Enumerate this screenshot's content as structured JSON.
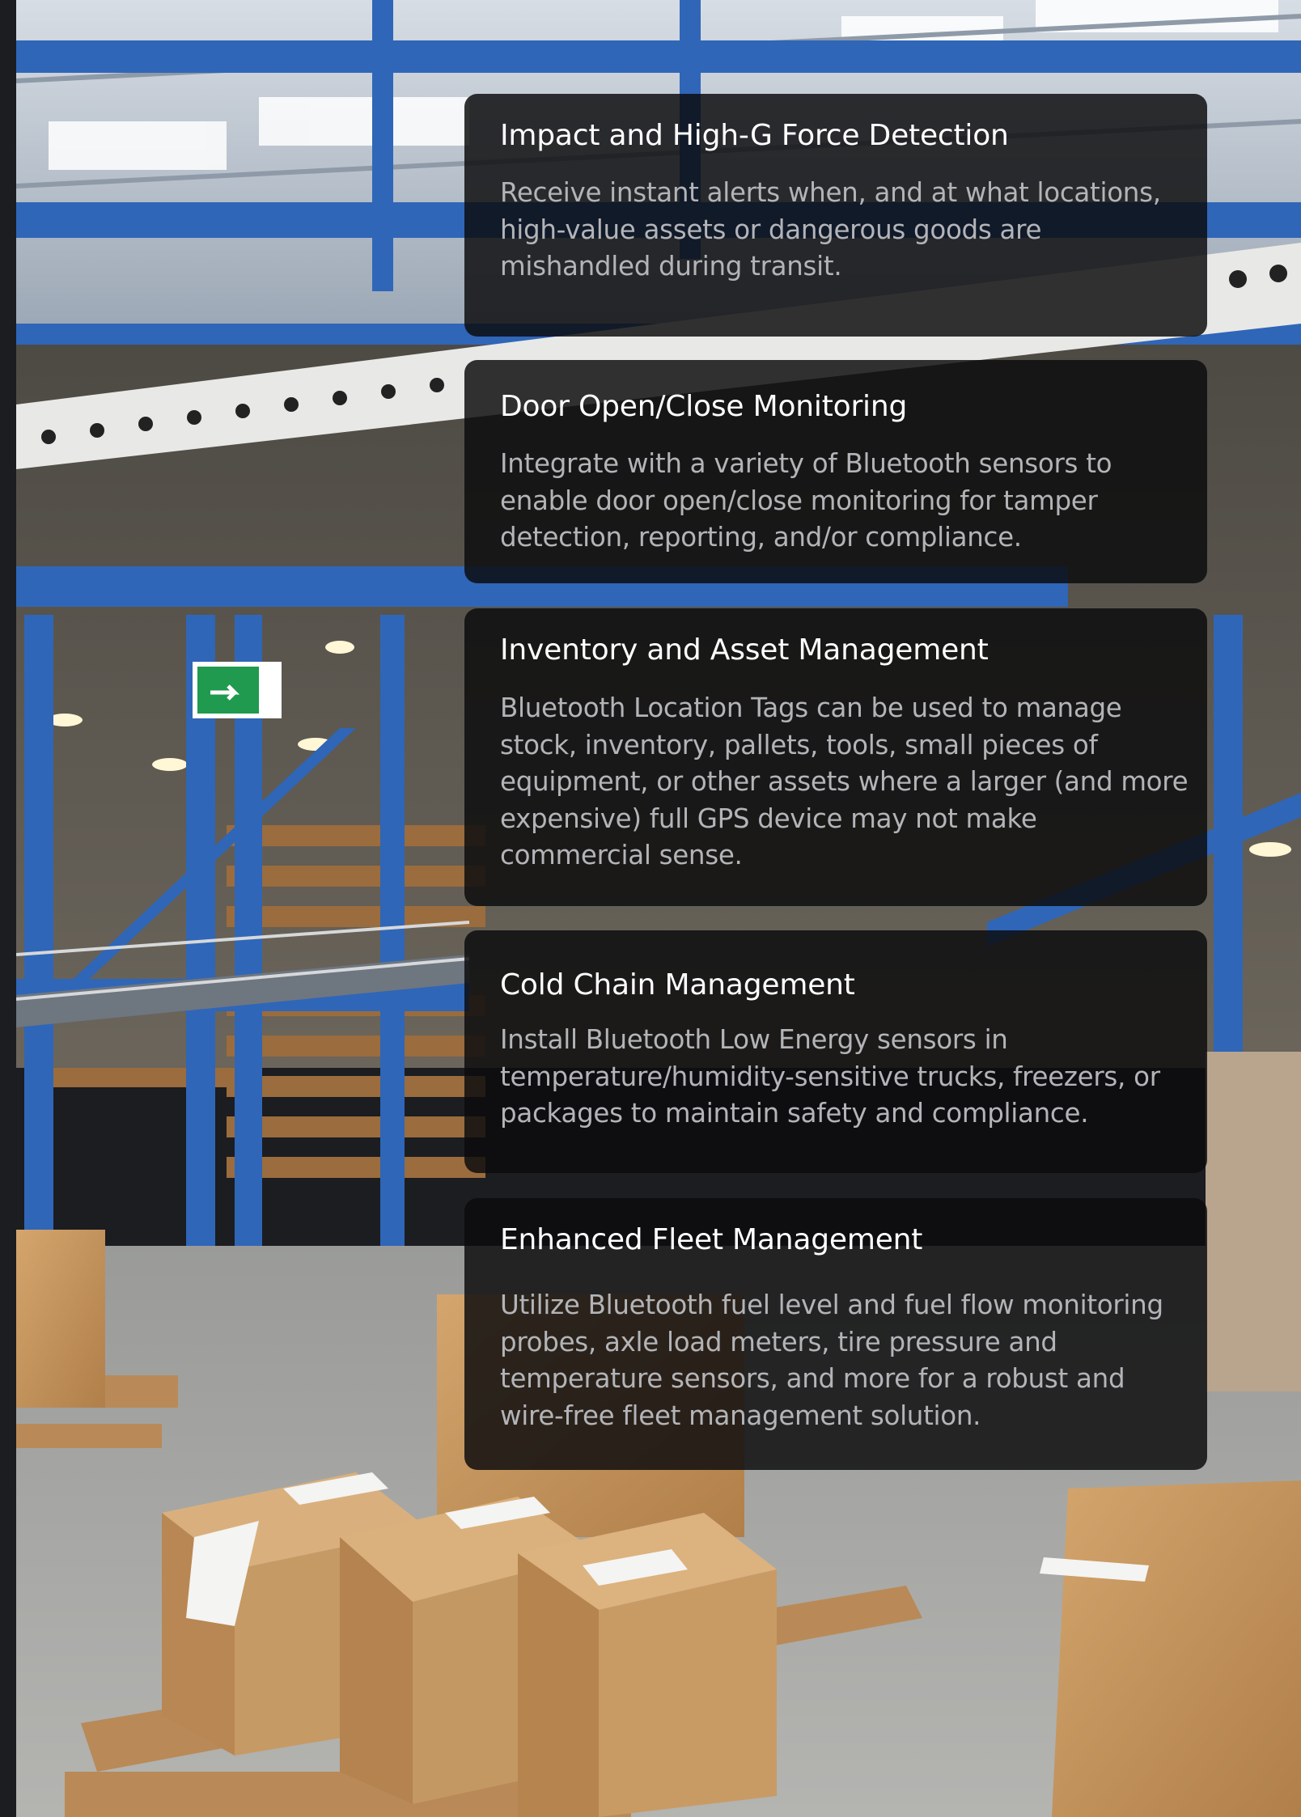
{
  "background": {
    "image_subject": "warehouse-conveyor-and-cardboard-boxes"
  },
  "colors": {
    "card_background": "#0c0c0d",
    "title_text": "#ffffff",
    "body_text": "#b3b4b8",
    "steel_blue": "#2f66b8",
    "cardboard": "#c2955f"
  },
  "cards": [
    {
      "title": "Impact and High-G Force Detection",
      "text": "Receive instant alerts when, and at what locations, high-value assets or dangerous goods are mishandled during transit."
    },
    {
      "title": "Door Open/Close Monitoring",
      "text": "Integrate with a variety of Bluetooth sensors to enable door open/close monitoring for tamper detection, reporting, and/or compliance."
    },
    {
      "title": "Inventory and Asset Management",
      "text": "Bluetooth Location Tags can be used to manage stock, inventory, pallets, tools, small pieces of equipment, or other assets where a larger (and more expensive) full GPS device may not make commercial sense."
    },
    {
      "title": "Cold Chain Management",
      "text": "Install Bluetooth Low Energy sensors in temperature/humidity-sensitive trucks, freezers, or packages to maintain safety and compliance."
    },
    {
      "title": "Enhanced Fleet Management",
      "text": "Utilize Bluetooth fuel level and fuel flow monitoring probes, axle load meters, tire pressure and temperature sensors, and more for a robust and wire-free fleet management solution."
    }
  ]
}
